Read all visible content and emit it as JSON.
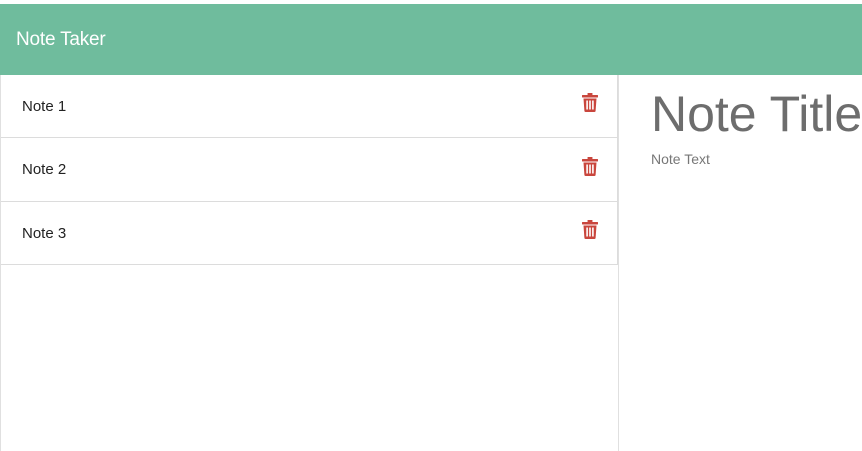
{
  "navbar": {
    "brand": "Note Taker",
    "background_color": "#6fbc9d"
  },
  "note_list": {
    "items": [
      {
        "title": "Note 1",
        "delete_icon": "trash-icon"
      },
      {
        "title": "Note 2",
        "delete_icon": "trash-icon"
      },
      {
        "title": "Note 3",
        "delete_icon": "trash-icon"
      }
    ],
    "delete_icon_color": "#c9463d"
  },
  "editor": {
    "title_placeholder": "Note Title",
    "text_placeholder": "Note Text"
  }
}
